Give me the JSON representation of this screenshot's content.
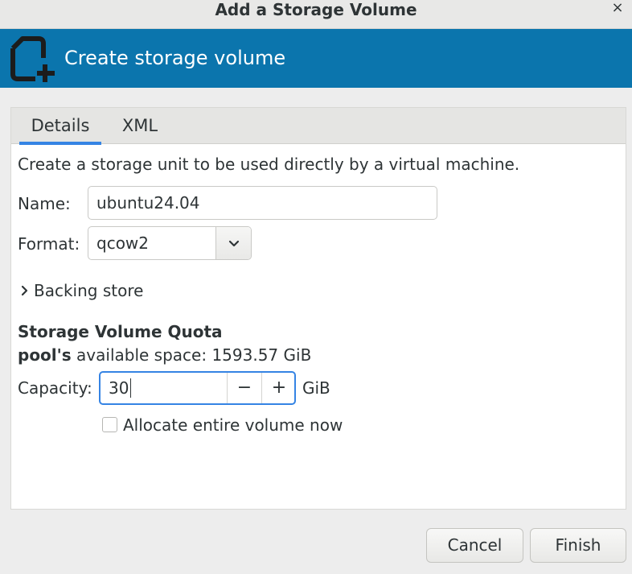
{
  "window": {
    "title": "Add a Storage Volume",
    "close_glyph": "×"
  },
  "header": {
    "title": "Create storage volume",
    "icon": "new-volume-icon",
    "background": "#0b75ad"
  },
  "tabs": [
    {
      "label": "Details",
      "active": true
    },
    {
      "label": "XML",
      "active": false
    }
  ],
  "details": {
    "description": "Create a storage unit to be used directly by a virtual machine.",
    "name": {
      "label": "Name:",
      "value": "ubuntu24.04"
    },
    "format": {
      "label": "Format:",
      "value": "qcow2"
    },
    "backing_store": {
      "label": "Backing store",
      "expanded": false
    }
  },
  "quota": {
    "title": "Storage Volume Quota",
    "pool_name": "pool's",
    "available_text": "available space: 1593.57 GiB",
    "capacity": {
      "label": "Capacity:",
      "value": "30",
      "unit": "GiB",
      "minus": "−",
      "plus": "+"
    },
    "allocate": {
      "label": "Allocate entire volume now",
      "checked": false
    }
  },
  "buttons": {
    "cancel": "Cancel",
    "finish": "Finish"
  },
  "colors": {
    "accent": "#3584e4",
    "banner": "#0b75ad"
  }
}
